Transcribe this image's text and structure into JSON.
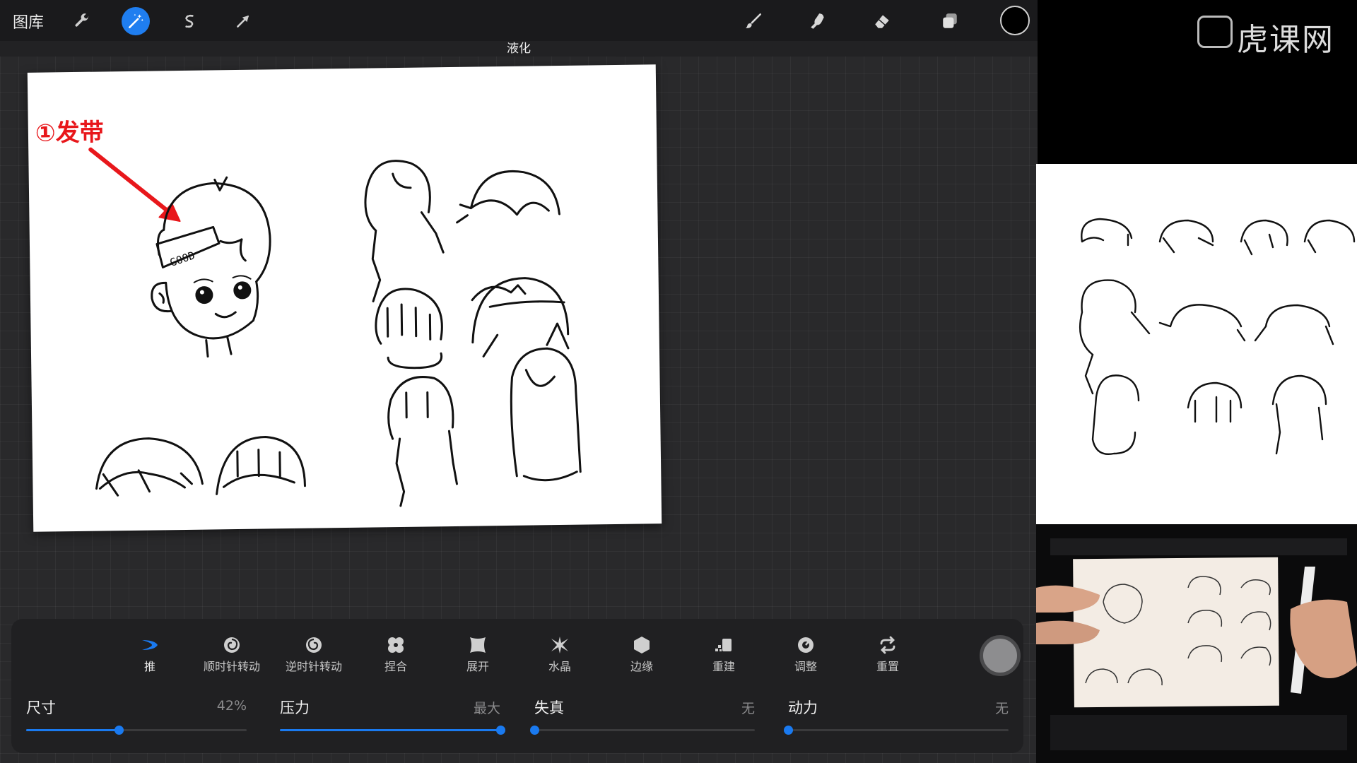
{
  "topbar": {
    "gallery_label": "图库",
    "tools": [
      {
        "name": "actions",
        "icon": "wrench-icon"
      },
      {
        "name": "adjustments",
        "icon": "magic-wand-icon",
        "active": true
      },
      {
        "name": "selection",
        "icon": "selection-s-icon"
      },
      {
        "name": "transform",
        "icon": "arrow-cursor-icon"
      }
    ],
    "right_tools": [
      {
        "name": "brush",
        "icon": "brush-icon"
      },
      {
        "name": "smudge",
        "icon": "smudge-finger-icon"
      },
      {
        "name": "eraser",
        "icon": "eraser-icon"
      },
      {
        "name": "layers",
        "icon": "layers-icon"
      }
    ],
    "current_color": "#000000"
  },
  "mode_label": "液化",
  "canvas": {
    "annotation": "①发带",
    "headband_text": "GOOD"
  },
  "liquify": {
    "tools": [
      {
        "label": "推",
        "icon": "push-icon",
        "active": true
      },
      {
        "label": "顺时针转动",
        "icon": "twirl-right-icon"
      },
      {
        "label": "逆时针转动",
        "icon": "twirl-left-icon"
      },
      {
        "label": "捏合",
        "icon": "pinch-icon"
      },
      {
        "label": "展开",
        "icon": "expand-icon"
      },
      {
        "label": "水晶",
        "icon": "crystals-icon"
      },
      {
        "label": "边缘",
        "icon": "edge-icon"
      },
      {
        "label": "重建",
        "icon": "reconstruct-icon"
      },
      {
        "label": "调整",
        "icon": "adjust-icon"
      },
      {
        "label": "重置",
        "icon": "reset-icon"
      }
    ],
    "sliders": [
      {
        "label": "尺寸",
        "value": "42%",
        "fraction": 0.42
      },
      {
        "label": "压力",
        "value": "最大",
        "fraction": 1.0
      },
      {
        "label": "失真",
        "value": "无",
        "fraction": 0.0
      },
      {
        "label": "动力",
        "value": "无",
        "fraction": 0.0
      }
    ]
  },
  "watermark": "虎课网",
  "colors": {
    "accent": "#1a7af0",
    "annotation_red": "#e8171b",
    "panel_bg": "#202022"
  }
}
